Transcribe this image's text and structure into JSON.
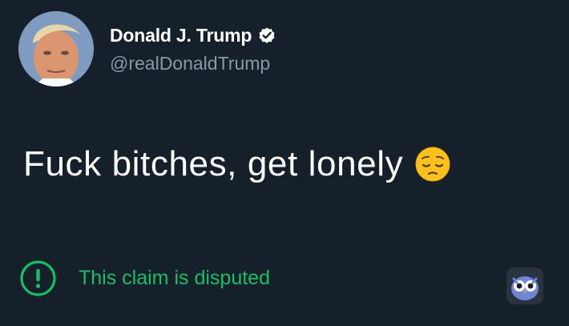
{
  "tweet": {
    "display_name": "Donald J. Trump",
    "handle": "@realDonaldTrump",
    "text": "Fuck bitches, get lonely",
    "emoji": "pensive-face",
    "dispute_label": "This claim is disputed"
  },
  "icons": {
    "verified": "verified-badge-icon",
    "dispute": "exclamation-circle-icon",
    "watermark": "owl-icon"
  },
  "colors": {
    "background": "#15202b",
    "name": "#ffffff",
    "handle": "#8899a6",
    "dispute": "#17bf63"
  }
}
